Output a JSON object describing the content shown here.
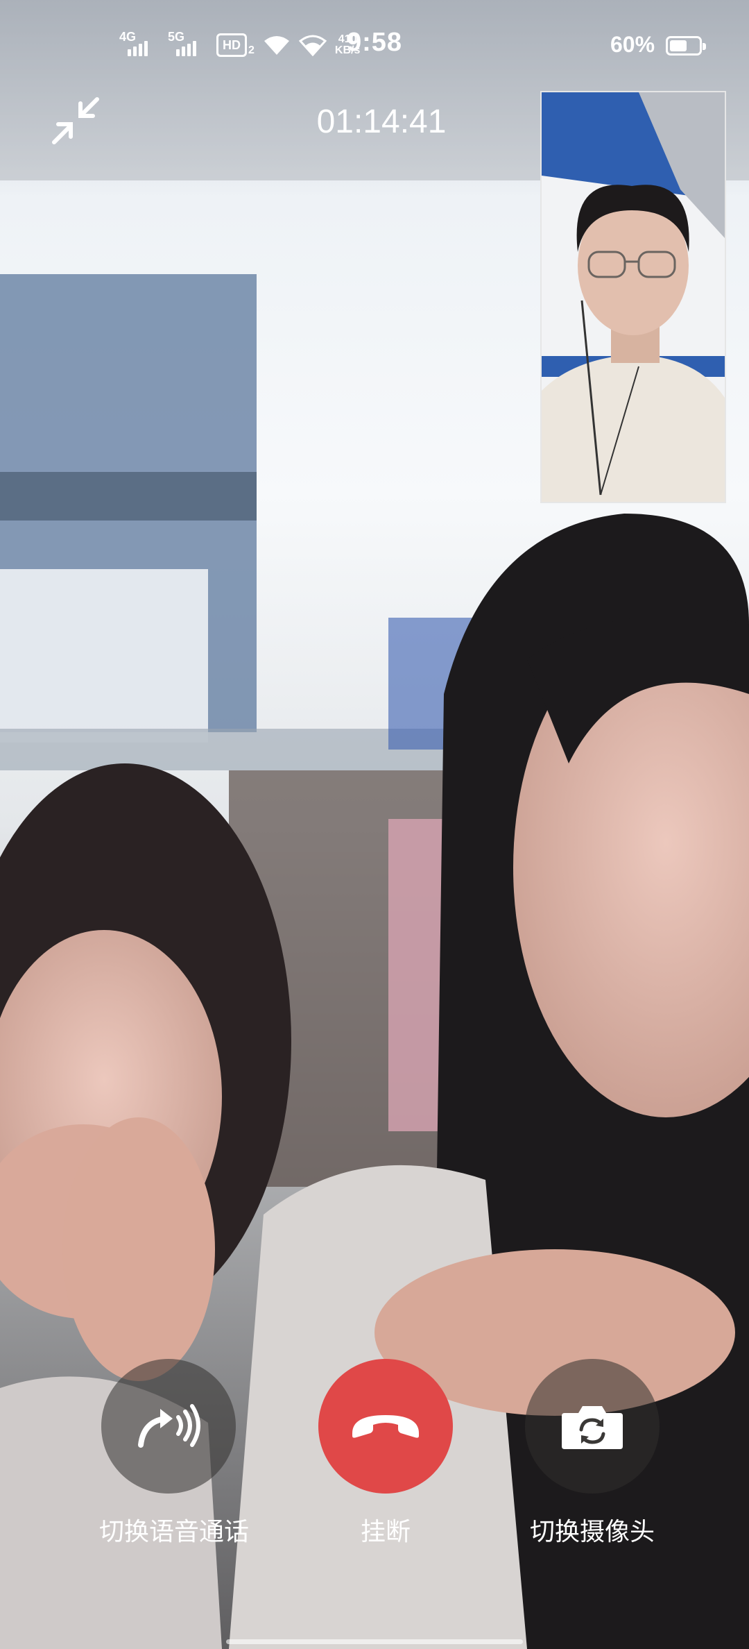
{
  "status_bar": {
    "network_1": "4G",
    "network_2": "5G",
    "hd_label": "HD",
    "hd_sub": "2",
    "speed_value": "410",
    "speed_unit": "KB/s",
    "time": "9:58",
    "battery_percent": "60%",
    "battery_level": 0.6
  },
  "call": {
    "timer": "01:14:41"
  },
  "controls": {
    "voice_switch_label": "切换语音通话",
    "hangup_label": "挂断",
    "camera_switch_label": "切换摄像头"
  },
  "colors": {
    "hangup": "#e04848",
    "control_bg": "rgba(50,48,46,0.55)"
  },
  "icons": {
    "minimize": "minimize-arrows-icon",
    "voice": "voice-call-icon",
    "hangup": "phone-hangup-icon",
    "camera": "camera-switch-icon"
  }
}
